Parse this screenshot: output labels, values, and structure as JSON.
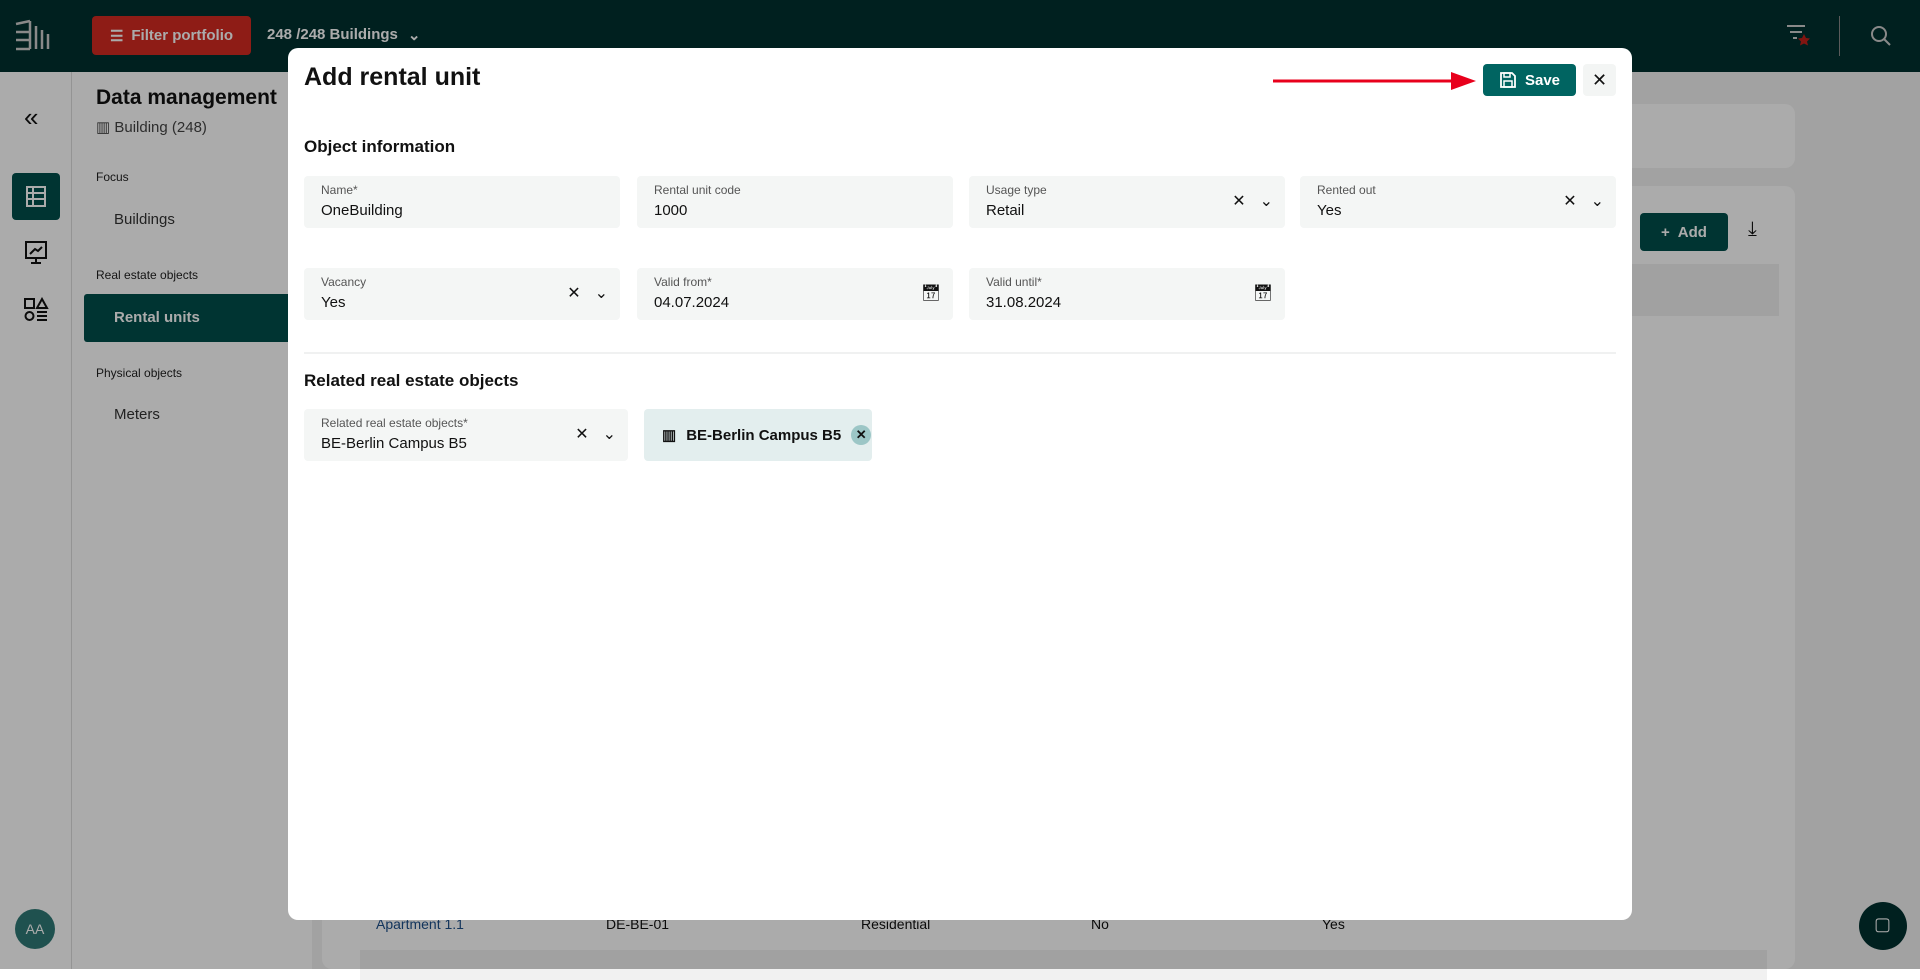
{
  "topbar": {
    "filter_label": "Filter portfolio",
    "building_count": "248 /248 Buildings"
  },
  "nav": {
    "title": "Data management",
    "subtitle": "Building (248)",
    "focus": "Focus",
    "buildings": "Buildings",
    "real_estate": "Real estate objects",
    "rental_units": "Rental units",
    "physical": "Physical objects",
    "meters": "Meters",
    "avatar": "AA"
  },
  "background": {
    "add_label": "Add",
    "row": {
      "name": "Apartment 1.1",
      "code": "DE-BE-01",
      "usage": "Residential",
      "rented": "No",
      "vacancy": "Yes"
    }
  },
  "modal": {
    "title": "Add rental unit",
    "save_label": "Save",
    "section1": "Object information",
    "section2": "Related real estate objects",
    "fields": [
      {
        "label": "Name*",
        "value": "OneBuilding"
      },
      {
        "label": "Rental unit code",
        "value": "1000"
      },
      {
        "label": "Usage type",
        "value": "Retail"
      },
      {
        "label": "Rented out",
        "value": "Yes"
      },
      {
        "label": "Vacancy",
        "value": "Yes"
      },
      {
        "label": "Valid from*",
        "value": "04.07.2024"
      },
      {
        "label": "Valid until*",
        "value": "31.08.2024"
      },
      {
        "label": "Related real estate objects*",
        "value": "BE-Berlin Campus B5"
      }
    ],
    "chip": "BE-Berlin Campus B5"
  },
  "colors": {
    "topbar": "#00302f",
    "filter": "#d42a22",
    "accent": "#006461",
    "annotation_arrow": "#e8001c"
  }
}
